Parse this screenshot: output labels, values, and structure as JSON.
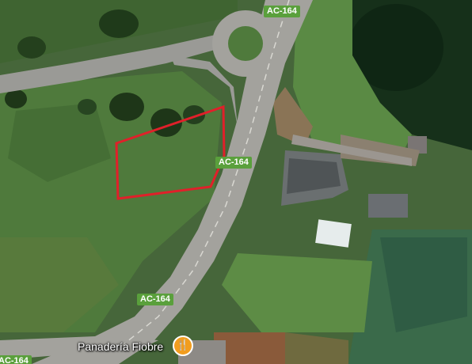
{
  "map": {
    "type": "satellite",
    "road_labels": [
      "AC-164",
      "AC-164",
      "AC-164",
      "AC-164"
    ],
    "poi": {
      "name": "Panadería Fiobre",
      "icon": "fork-knife-icon",
      "color": "#f29d1f"
    },
    "parcel_outline_color": "#e0202a"
  }
}
